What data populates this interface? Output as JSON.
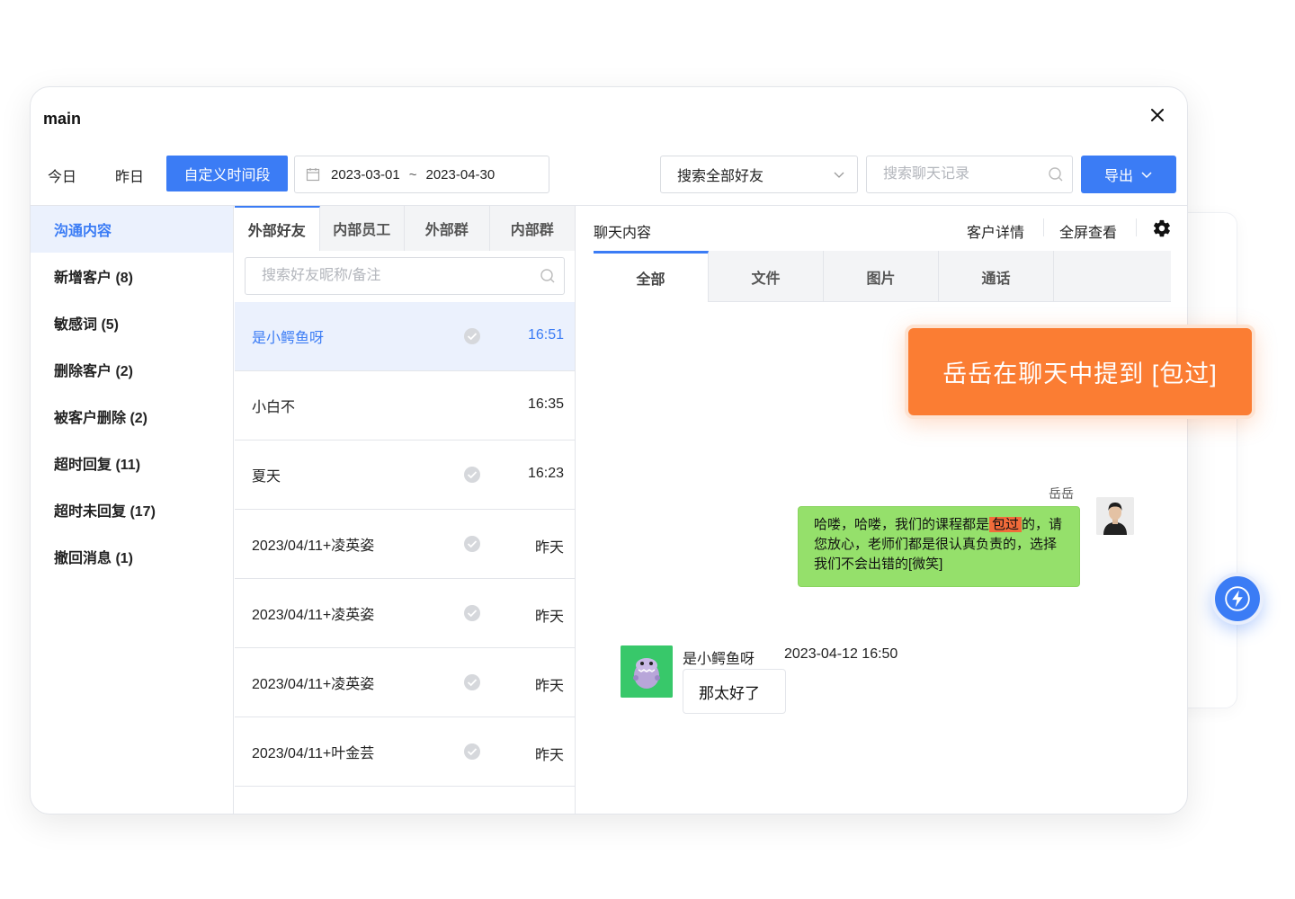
{
  "window": {
    "title": "main"
  },
  "toolbar": {
    "today": "今日",
    "yesterday": "昨日",
    "custom_range": "自定义时间段",
    "date_start": "2023-03-01",
    "date_sep": "~",
    "date_end": "2023-04-30",
    "friend_select": "搜索全部好友",
    "chat_search_placeholder": "搜索聊天记录",
    "export": "导出"
  },
  "sidebar": {
    "items": [
      {
        "label": "沟通内容",
        "active": true
      },
      {
        "label": "新增客户 (8)"
      },
      {
        "label": "敏感词 (5)"
      },
      {
        "label": "删除客户 (2)"
      },
      {
        "label": "被客户删除 (2)"
      },
      {
        "label": "超时回复 (11)"
      },
      {
        "label": "超时未回复 (17)"
      },
      {
        "label": "撤回消息 (1)"
      }
    ]
  },
  "list": {
    "tabs": [
      "外部好友",
      "内部员工",
      "外部群",
      "内部群"
    ],
    "search_placeholder": "搜索好友昵称/备注",
    "rows": [
      {
        "name": "是小鳄鱼呀",
        "time": "16:51",
        "checked": true,
        "active": true
      },
      {
        "name": "小白不",
        "time": "16:35",
        "checked": false
      },
      {
        "name": "夏天",
        "time": "16:23",
        "checked": true
      },
      {
        "name": "2023/04/11+凌英姿",
        "time": "昨天",
        "checked": true
      },
      {
        "name": "2023/04/11+凌英姿",
        "time": "昨天",
        "checked": true
      },
      {
        "name": "2023/04/11+凌英姿",
        "time": "昨天",
        "checked": true
      },
      {
        "name": "2023/04/11+叶金芸",
        "time": "昨天",
        "checked": true
      }
    ]
  },
  "chat": {
    "title": "聊天内容",
    "customer_detail": "客户详情",
    "fullscreen": "全屏查看",
    "tabs": [
      "全部",
      "文件",
      "图片",
      "通话"
    ],
    "messages": [
      {
        "sender": "岳岳",
        "text_before": "哈喽，哈喽，我们的课程都是",
        "keyword": "包过",
        "text_after": "的，请您放心，老师们都是很认真负责的，选择我们不会出错的[微笑]"
      },
      {
        "sender": "是小鳄鱼呀",
        "time": "2023-04-12 16:50",
        "text": "那太好了"
      }
    ]
  },
  "alert": {
    "text": "岳岳在聊天中提到 [包过]"
  },
  "colors": {
    "accent": "#3b7cf5",
    "alert": "#fb7d33",
    "bubble": "#95e06b",
    "keyword": "#f26b3a"
  },
  "icons": [
    "close-icon",
    "calendar-icon",
    "chevron-down-icon",
    "search-icon",
    "check-circle-icon",
    "gear-icon",
    "lightning-icon"
  ]
}
